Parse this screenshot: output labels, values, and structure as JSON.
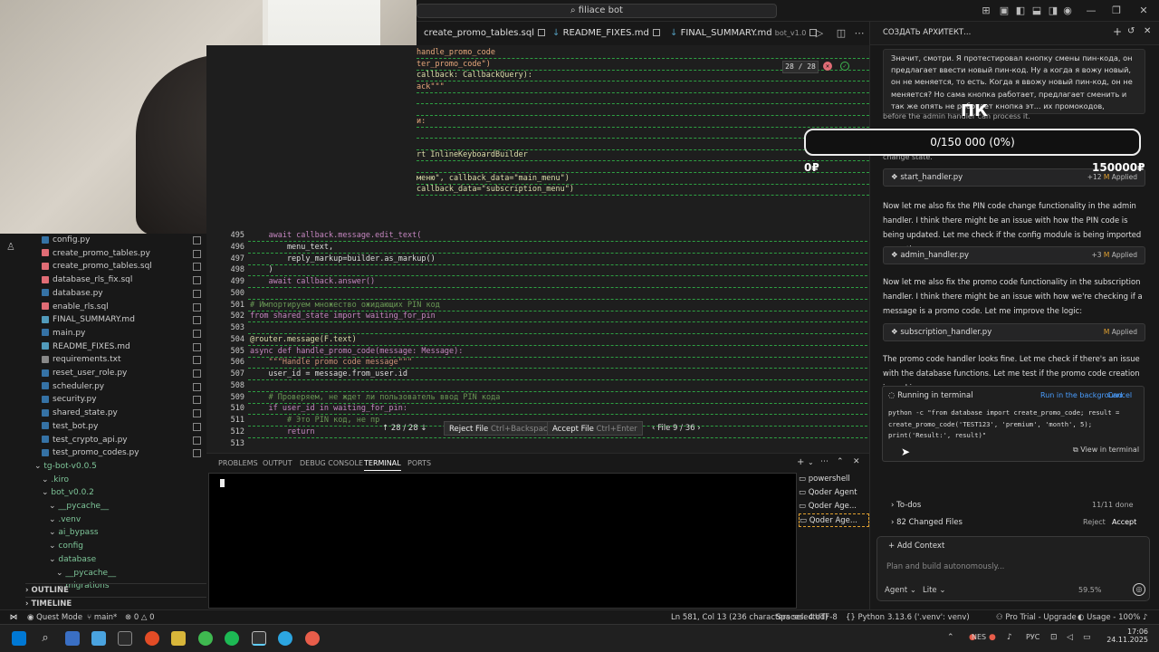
{
  "titlebar": {
    "search": "filiace bot"
  },
  "tabs": [
    {
      "label": "create_promo_tables.sql"
    },
    {
      "label": "README_FIXES.md"
    },
    {
      "label": "FINAL_SUMMARY.md",
      "extra": "bot_v1.0"
    }
  ],
  "chat": {
    "title": "СОЗДАТЬ АРХИТЕКТ...",
    "user_msg": "Значит, смотри. Я протестировал кнопку смены пин-кода, он предлагает ввести новый пин-код. Ну а когда я вожу новый, он не меняется, то есть. Когда я ввожу новый пин-код, он не меняется? Но сама кнопка работает, предлагает сменить и так же опять не работает кнопка эт... их промокодов, исправь. Пожалуйста",
    "truncated_line_1": "before the admin handler can process it.",
    "truncated_line_2": "change state.",
    "overlay_code": "ПК",
    "progress_text": "0/150 000 (0%)",
    "zero_label": "0₽",
    "goal_label": "150000₽",
    "file1": {
      "name": "start_handler.py",
      "diff": "+12",
      "mark": "M",
      "status": "Applied"
    },
    "msg2": "Now let me also fix the PIN code change functionality in the admin handler. I think there might be an issue with how the PIN code is being updated. Let me check if the config module is being imported correctly:",
    "file2": {
      "name": "admin_handler.py",
      "diff": "+3",
      "mark": "M",
      "status": "Applied"
    },
    "msg3": "Now let me also fix the promo code functionality in the subscription handler. I think there might be an issue with how we're checking if a message is a promo code. Let me improve the logic:",
    "file3": {
      "name": "subscription_handler.py",
      "mark": "M",
      "status": "Applied"
    },
    "msg4": "The promo code handler looks fine. Let me check if there's an issue with the database functions. Let me test if the promo code creation is working:",
    "run_title": "Running in terminal",
    "run_bg": "Run in the background",
    "run_cancel": "Cancel",
    "run_cmd": "python -c \"from database import create_promo_code; result = create_promo_code('TEST123', 'premium', 'month', 5); print('Result:', result)\"",
    "view_terminal": "View in terminal",
    "todos": "To-dos",
    "todos_count": "11/11 done",
    "changed": "82 Changed Files",
    "reject": "Reject",
    "accept": "Accept",
    "add_context": "Add Context",
    "input_placeholder": "Plan and build autonomously...",
    "mode": "Agent",
    "model": "Lite",
    "usage": "59.5%"
  },
  "editor": {
    "diff_counter": "28 / 28",
    "top_lines": [
      "handle_promo_code",
      "ter_promo_code\")",
      "callback: CallbackQuery):",
      "ack\"\"\"",
      "",
      "",
      "и:",
      "",
      "",
      "rt InlineKeyboardBuilder",
      "",
      "меню\", callback_data=\"main_menu\")",
      "callback_data=\"subscription_menu\")"
    ],
    "lines": [
      {
        "n": "495",
        "t": "    await callback.message.edit_text("
      },
      {
        "n": "496",
        "t": "        menu_text,"
      },
      {
        "n": "497",
        "t": "        reply_markup=builder.as_markup()"
      },
      {
        "n": "498",
        "t": "    )"
      },
      {
        "n": "499",
        "t": "    await callback.answer()"
      },
      {
        "n": "500",
        "t": ""
      },
      {
        "n": "501",
        "t": "# Импортируем множество ожидающих PIN код"
      },
      {
        "n": "502",
        "t": "from shared_state import waiting_for_pin"
      },
      {
        "n": "503",
        "t": ""
      },
      {
        "n": "504",
        "t": "@router.message(F.text)"
      },
      {
        "n": "505",
        "t": "async def handle_promo_code(message: Message):"
      },
      {
        "n": "506",
        "t": "    \"\"\"Handle promo code message\"\"\""
      },
      {
        "n": "507",
        "t": "    user_id = message.from_user.id"
      },
      {
        "n": "508",
        "t": ""
      },
      {
        "n": "509",
        "t": "    # Проверяем, не ждет ли пользователь ввод PIN кода"
      },
      {
        "n": "510",
        "t": "    if user_id in waiting_for_pin:"
      },
      {
        "n": "511",
        "t": "        # Это PIN код, не пр"
      },
      {
        "n": "512",
        "t": "        return"
      },
      {
        "n": "513",
        "t": ""
      }
    ],
    "diffbar": {
      "counter": "28 / 28",
      "reject": "Reject File",
      "reject_key": "Ctrl+Backspace",
      "accept": "Accept File",
      "accept_key": "Ctrl+Enter",
      "file": "File 9 / 36"
    }
  },
  "explorer": {
    "items": [
      {
        "label": "config.py",
        "indent": 1,
        "color": "#3572A5"
      },
      {
        "label": "create_promo_tables.py",
        "indent": 1,
        "color": "#e06c75"
      },
      {
        "label": "create_promo_tables.sql",
        "indent": 1,
        "color": "#e06c75"
      },
      {
        "label": "database_rls_fix.sql",
        "indent": 1,
        "color": "#e06c75"
      },
      {
        "label": "database.py",
        "indent": 1,
        "color": "#3572A5"
      },
      {
        "label": "enable_rls.sql",
        "indent": 1,
        "color": "#e06c75"
      },
      {
        "label": "FINAL_SUMMARY.md",
        "indent": 1,
        "color": "#519aba"
      },
      {
        "label": "main.py",
        "indent": 1,
        "color": "#3572A5"
      },
      {
        "label": "README_FIXES.md",
        "indent": 1,
        "color": "#519aba"
      },
      {
        "label": "requirements.txt",
        "indent": 1,
        "color": "#888888"
      },
      {
        "label": "reset_user_role.py",
        "indent": 1,
        "color": "#3572A5"
      },
      {
        "label": "scheduler.py",
        "indent": 1,
        "color": "#3572A5"
      },
      {
        "label": "security.py",
        "indent": 1,
        "color": "#3572A5"
      },
      {
        "label": "shared_state.py",
        "indent": 1,
        "color": "#3572A5"
      },
      {
        "label": "test_bot.py",
        "indent": 1,
        "color": "#3572A5"
      },
      {
        "label": "test_crypto_api.py",
        "indent": 1,
        "color": "#3572A5"
      },
      {
        "label": "test_promo_codes.py",
        "indent": 1,
        "color": "#3572A5"
      },
      {
        "label": "tg-bot-v0.0.5",
        "indent": 0,
        "folder": true
      },
      {
        "label": ".kiro",
        "indent": 1,
        "folder": true
      },
      {
        "label": "bot_v0.0.2",
        "indent": 1,
        "folder": true
      },
      {
        "label": "__pycache__",
        "indent": 2,
        "folder": true
      },
      {
        "label": ".venv",
        "indent": 2,
        "folder": true
      },
      {
        "label": "ai_bypass",
        "indent": 2,
        "folder": true
      },
      {
        "label": "config",
        "indent": 2,
        "folder": true
      },
      {
        "label": "database",
        "indent": 2,
        "folder": true
      },
      {
        "label": "__pycache__",
        "indent": 3,
        "folder": true
      },
      {
        "label": "migrations",
        "indent": 3,
        "folder": true
      }
    ],
    "outline": "OUTLINE",
    "timeline": "TIMELINE"
  },
  "panel": {
    "tabs": [
      "PROBLEMS",
      "OUTPUT",
      "DEBUG CONSOLE",
      "TERMINAL",
      "PORTS"
    ],
    "terminals": [
      "powershell",
      "Qoder Agent",
      "Qoder Age...",
      "Qoder Age..."
    ]
  },
  "statusbar": {
    "left": [
      "Quest Mode",
      "main*",
      "⊗ 0 △ 0"
    ],
    "right": [
      "Ln 581, Col 13 (236 characters selected)",
      "Spaces: 4",
      "UTF-8",
      "Python",
      "3.13.6 ('.venv': venv)",
      "Pro Trial - Upgrade",
      "Usage - 100%"
    ]
  },
  "taskbar": {
    "lang": "NES",
    "keyboard": "РУС",
    "time": "17:06",
    "date": "24.11.2025"
  }
}
